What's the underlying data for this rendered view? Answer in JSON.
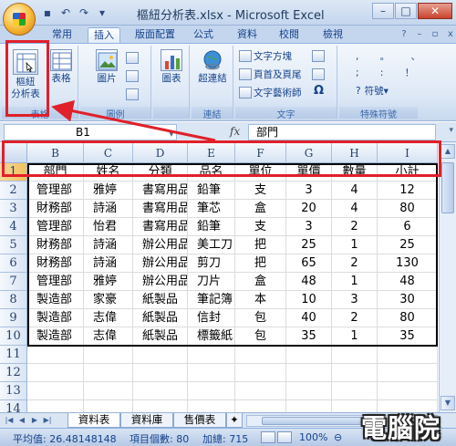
{
  "window": {
    "title": "樞紐分析表.xlsx - Microsoft Excel",
    "minimize_icon": "minimize-icon",
    "maximize_icon": "maximize-icon",
    "close_icon": "close-icon"
  },
  "tabs": [
    {
      "label": "常用"
    },
    {
      "label": "插入"
    },
    {
      "label": "版面配置"
    },
    {
      "label": "公式"
    },
    {
      "label": "資料"
    },
    {
      "label": "校閱"
    },
    {
      "label": "檢視"
    }
  ],
  "ribbon": {
    "tables": {
      "pivot_line1": "樞紐",
      "pivot_line2": "分析表",
      "table": "表格",
      "group": "表格"
    },
    "illustrations": {
      "picture": "圖片",
      "group": "圖例"
    },
    "charts": {
      "chart": "圖表"
    },
    "links": {
      "hyperlink": "超連結",
      "group": "連結"
    },
    "text": {
      "textbox": "文字方塊",
      "header_footer": "頁首及頁尾",
      "wordart": "文字藝術師",
      "group": "文字"
    },
    "symbols": {
      "symbol": "符號",
      "group": "特殊符號"
    }
  },
  "formula_bar": {
    "name_box": "B1",
    "fx": "fx",
    "value": "部門"
  },
  "columns": [
    "B",
    "C",
    "D",
    "E",
    "F",
    "G",
    "H",
    "I"
  ],
  "rows": [
    "1",
    "2",
    "3",
    "4",
    "5",
    "6",
    "7",
    "8",
    "9",
    "10",
    "11",
    "12",
    "13",
    "14"
  ],
  "table": {
    "headers": [
      "部門",
      "姓名",
      "分類",
      "品名",
      "單位",
      "單價",
      "數量",
      "小計"
    ],
    "data": [
      [
        "管理部",
        "雅婷",
        "書寫用品",
        "鉛筆",
        "支",
        "3",
        "4",
        "12"
      ],
      [
        "財務部",
        "詩涵",
        "書寫用品",
        "筆芯",
        "盒",
        "20",
        "4",
        "80"
      ],
      [
        "管理部",
        "怡君",
        "書寫用品",
        "鉛筆",
        "支",
        "3",
        "2",
        "6"
      ],
      [
        "財務部",
        "詩涵",
        "辦公用品",
        "美工刀",
        "把",
        "25",
        "1",
        "25"
      ],
      [
        "財務部",
        "詩涵",
        "辦公用品",
        "剪刀",
        "把",
        "65",
        "2",
        "130"
      ],
      [
        "管理部",
        "雅婷",
        "辦公用品",
        "刀片",
        "盒",
        "48",
        "1",
        "48"
      ],
      [
        "製造部",
        "家豪",
        "紙製品",
        "筆記簿",
        "本",
        "10",
        "3",
        "30"
      ],
      [
        "製造部",
        "志偉",
        "紙製品",
        "信封",
        "包",
        "40",
        "2",
        "80"
      ],
      [
        "製造部",
        "志偉",
        "紙製品",
        "標籤紙",
        "包",
        "35",
        "1",
        "35"
      ]
    ]
  },
  "sheets": [
    "資料表",
    "資料庫",
    "售價表"
  ],
  "status": {
    "average": "平均值: 26.48148148",
    "count": "項目個數: 80",
    "sum": "加總: 715",
    "zoom": "100%"
  },
  "watermark": "電腦院"
}
